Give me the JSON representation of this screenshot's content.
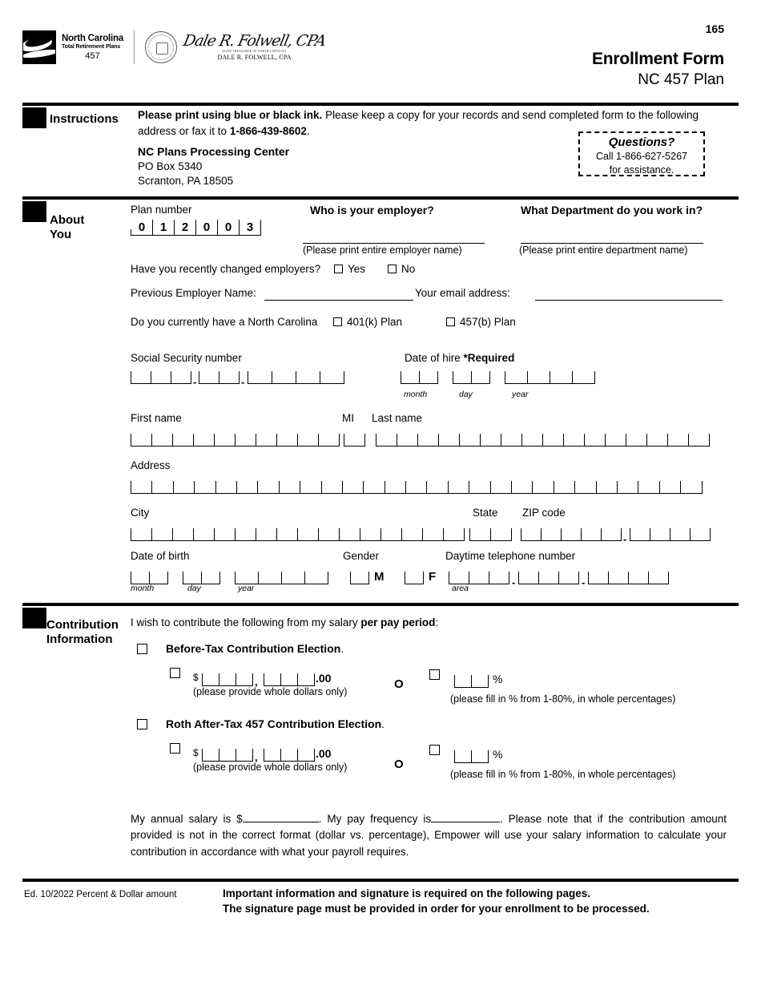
{
  "header": {
    "page_number": "165",
    "title": "Enrollment Form",
    "subtitle": "NC 457 Plan",
    "logo": {
      "line1": "North Carolina",
      "line2": "Total Retirement Plans",
      "line3": "457"
    },
    "treasurer": {
      "signature": "Dale R. Folwell, CPA",
      "seal_caption": "STATE TREASURER OF NORTH CAROLINA",
      "printed_name": "DALE R. FOLWELL, CPA"
    }
  },
  "instructions": {
    "section_label": "Instructions",
    "line1_bold": "Please print using blue or black ink.",
    "line1_rest": " Please keep a copy for your records and send completed form to the following address or fax it to ",
    "fax": "1-866-439-8602",
    "period": ".",
    "address_name": "NC Plans Processing Center",
    "address_box": "PO Box 5340",
    "address_city": "Scranton, PA  18505",
    "questions": {
      "heading": "Questions?",
      "phone_line": "Call 1-866-627-5267",
      "assist_line": "for assistance."
    }
  },
  "about_you": {
    "section_label_line1": "About",
    "section_label_line2": "You",
    "plan_number_label": "Plan number",
    "plan_number_digits": [
      "0",
      "1",
      "2",
      "0",
      "0",
      "3"
    ],
    "employer_question": "Who is your employer?",
    "employer_hint": "(Please print entire employer name)",
    "department_question": "What Department do you work in?",
    "department_hint": "(Please print entire department name)",
    "changed_employers_question": "Have you recently changed employers?",
    "yes_label": "Yes",
    "no_label": "No",
    "previous_employer_label": "Previous Employer Name:",
    "email_label": "Your email address:",
    "nc_plan_question": "Do you currently have a North Carolina",
    "plan_401k_label": "401(k) Plan",
    "plan_457b_label": "457(b) Plan",
    "ssn_label": "Social Security number",
    "date_of_hire_label": "Date of hire ",
    "date_of_hire_required": "*Required",
    "month_hint": "month",
    "day_hint": "day",
    "year_hint": "year",
    "first_name_label": "First name",
    "mi_label": "MI",
    "last_name_label": "Last name",
    "address_label": "Address",
    "city_label": "City",
    "state_label": "State",
    "zip_label": "ZIP code",
    "dob_label": "Date of birth",
    "gender_label": "Gender",
    "gender_m": "M",
    "gender_f": "F",
    "phone_label": "Daytime telephone number",
    "area_hint": "area"
  },
  "contribution": {
    "section_label_line1": "Contribution",
    "section_label_line2": "Information",
    "intro_plain": "I wish to contribute the following from my salary ",
    "intro_bold": "per pay period",
    "intro_colon": ":",
    "before_tax_bold": "Before-Tax Contribution Election",
    "before_tax_period": ".",
    "roth_bold": "Roth After-Tax 457 Contribution Election",
    "roth_period": ".",
    "dollar_sign": "$",
    "comma": ",",
    "cents": ".00",
    "dollar_hint": "(please provide whole dollars only)",
    "or_label": "O",
    "percent_sign": "%",
    "percent_hint": "(please fill in % from 1-80%, in whole percentages)",
    "salary_paragraph_part1": "My annual salary is $",
    "salary_paragraph_part2": ".  My pay frequency is",
    "salary_paragraph_part3": ". Please note that if the contribution amount provided is not in the correct format (dollar vs. percentage), Empower will use your salary information to calculate your contribution in accordance with what your payroll requires."
  },
  "footer": {
    "edition": "Ed. 10/2022 Percent & Dollar amount",
    "notice_line1": "Important information and signature is required on the following pages.",
    "notice_line2": "The signature page must be provided in order for your enrollment to be processed."
  }
}
